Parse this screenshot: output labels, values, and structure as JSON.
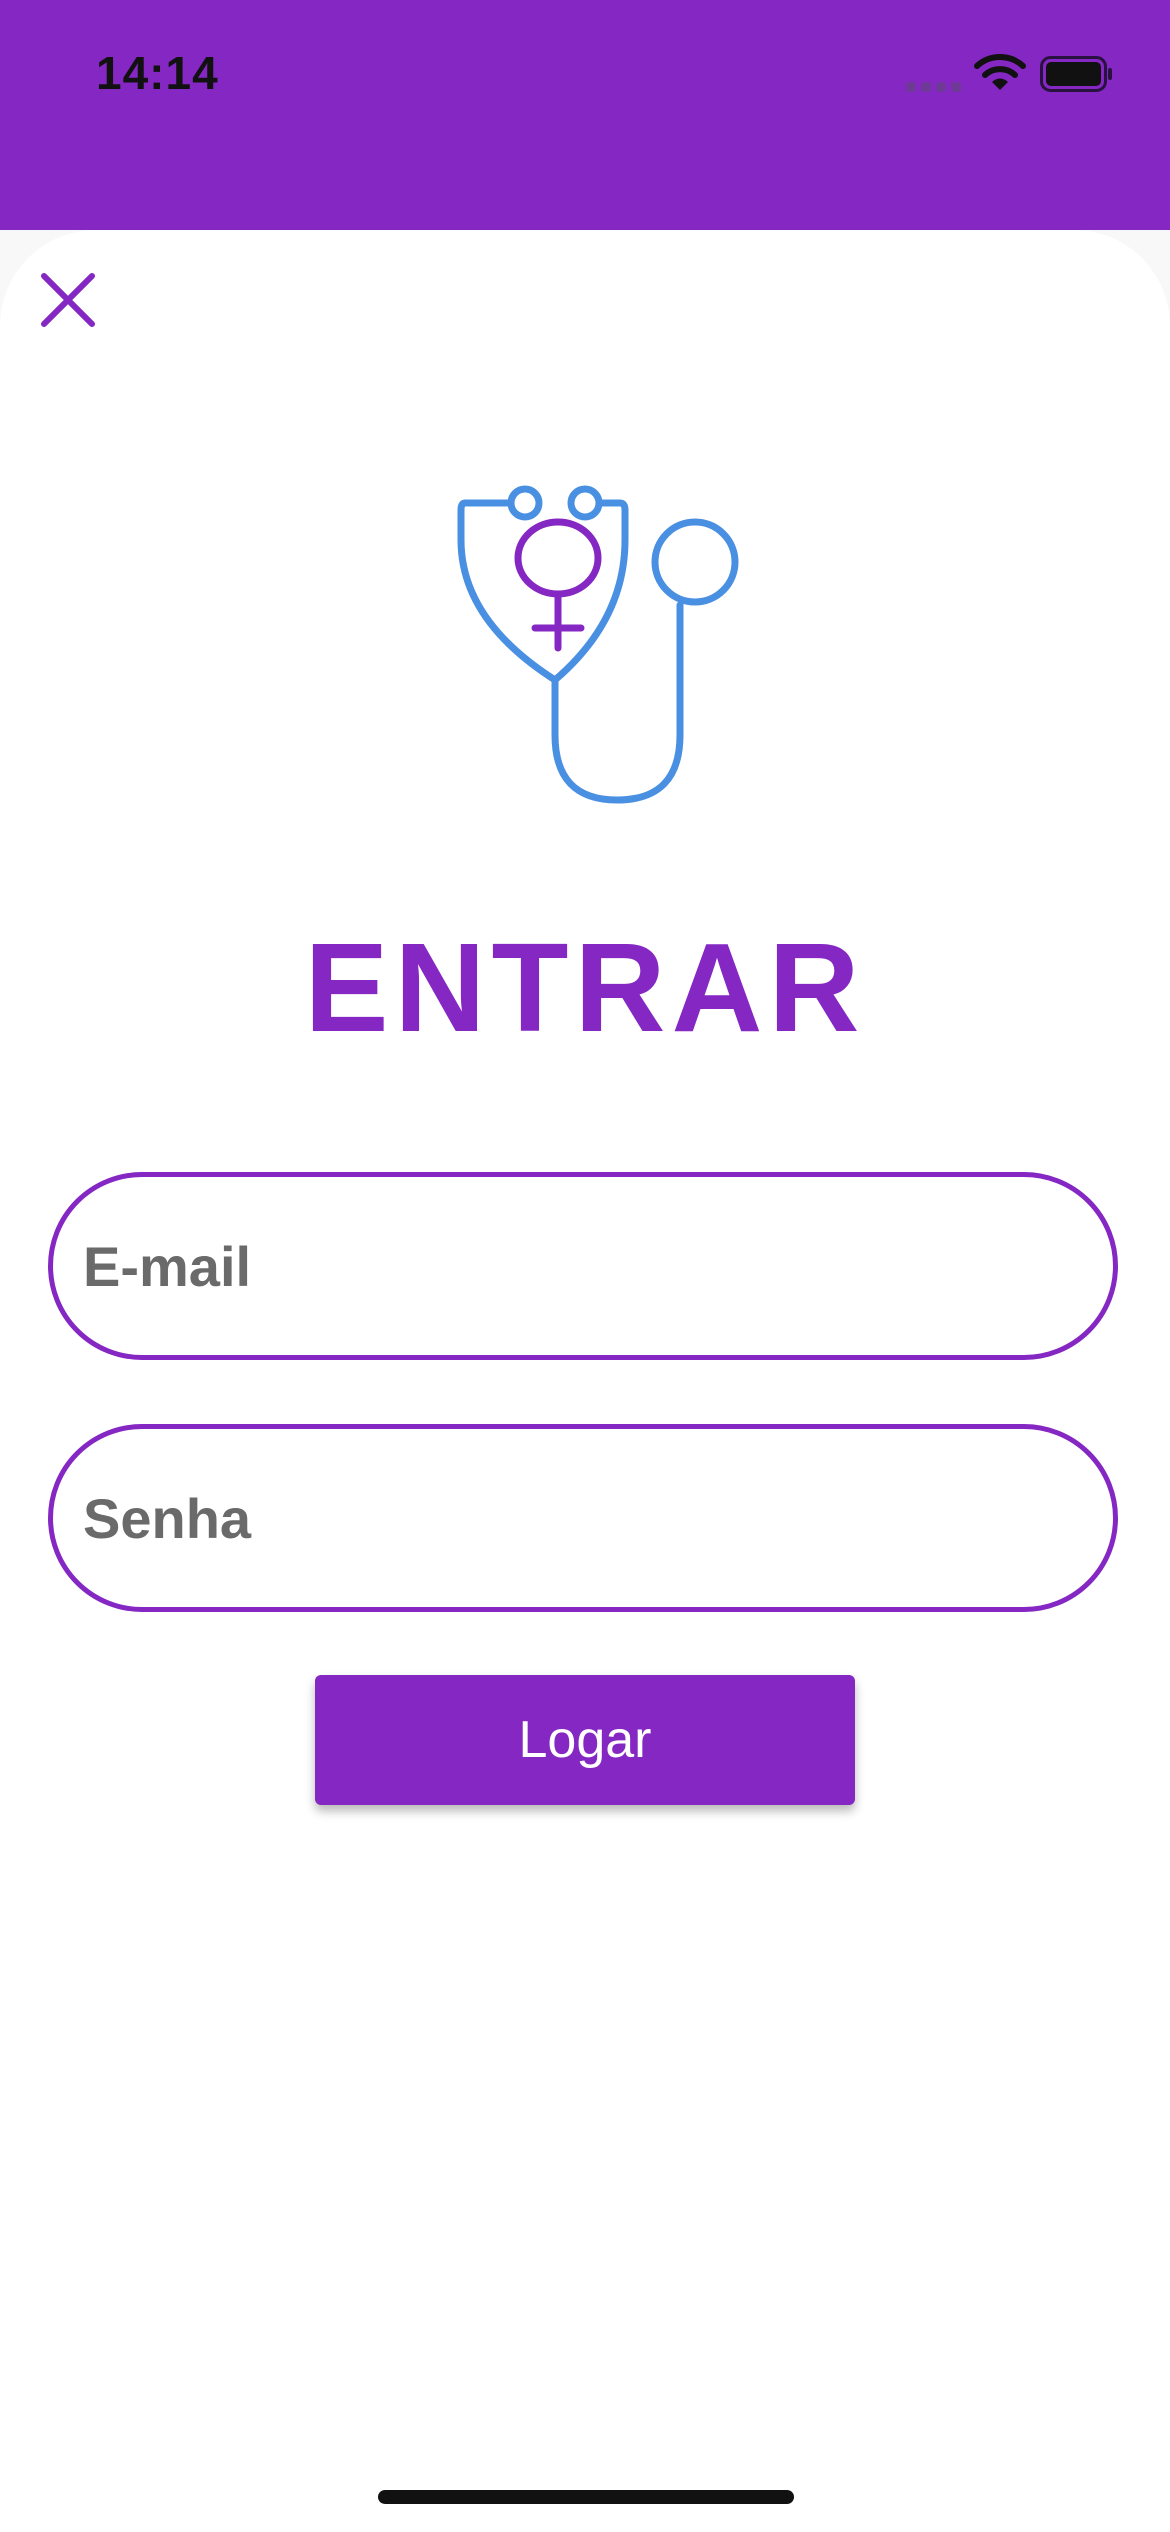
{
  "status_bar": {
    "time": "14:14",
    "background_color": "#8527C3",
    "icons": [
      "signal-icon",
      "wifi-icon",
      "battery-icon"
    ]
  },
  "header": {
    "close_icon": "close-icon"
  },
  "logo": {
    "icon": "stethoscope-female-icon",
    "colors": {
      "stethoscope": "#4A90E2",
      "symbol": "#8527C3"
    }
  },
  "title": "ENTRAR",
  "form": {
    "email_placeholder": "E-mail",
    "email_value": "",
    "password_placeholder": "Senha",
    "password_value": "",
    "submit_label": "Logar"
  },
  "colors": {
    "accent": "#8527C3",
    "placeholder": "#6A6A6A",
    "background": "#FFFFFF"
  }
}
